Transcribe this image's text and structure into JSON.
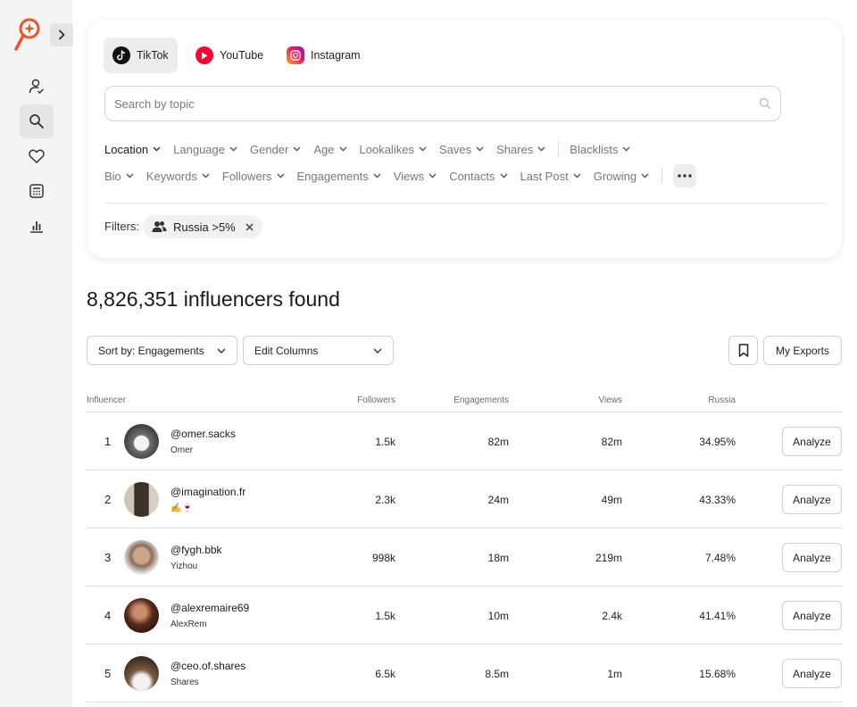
{
  "platforms": [
    {
      "label": "TikTok",
      "icon": "tiktok-icon",
      "active": true
    },
    {
      "label": "YouTube",
      "icon": "youtube-icon",
      "active": false
    },
    {
      "label": "Instagram",
      "icon": "instagram-icon",
      "active": false
    }
  ],
  "search": {
    "placeholder": "Search by topic",
    "value": ""
  },
  "filters_row1": [
    "Location",
    "Language",
    "Gender",
    "Age",
    "Lookalikes",
    "Saves",
    "Shares",
    "Blacklists"
  ],
  "filters_row2": [
    "Bio",
    "Keywords",
    "Followers",
    "Engagements",
    "Views",
    "Contacts",
    "Last Post",
    "Growing"
  ],
  "active_filters": {
    "label": "Filters:",
    "chips": [
      "Russia >5%"
    ]
  },
  "results": {
    "title": "8,826,351 influencers found"
  },
  "controls": {
    "sort_label": "Sort by: Engagements",
    "columns_label": "Edit Columns",
    "exports_label": "My Exports"
  },
  "table": {
    "headers": {
      "influencer": "Influencer",
      "followers": "Followers",
      "engagements": "Engagements",
      "views": "Views",
      "location": "Russia"
    },
    "action_label": "Analyze",
    "rows": [
      {
        "rank": "1",
        "handle": "@omer.sacks",
        "name": "Omer",
        "followers": "1.5k",
        "engagements": "82m",
        "views": "82m",
        "location_pct": "34.95%"
      },
      {
        "rank": "2",
        "handle": "@imagination.fr",
        "name": "✍️🍷",
        "followers": "2.3k",
        "engagements": "24m",
        "views": "49m",
        "location_pct": "43.33%"
      },
      {
        "rank": "3",
        "handle": "@fygh.bbk",
        "name": "Yizhou",
        "followers": "998k",
        "engagements": "18m",
        "views": "219m",
        "location_pct": "7.48%"
      },
      {
        "rank": "4",
        "handle": "@alexremaire69",
        "name": "AlexRem",
        "followers": "1.5k",
        "engagements": "10m",
        "views": "2.4k",
        "location_pct": "41.41%"
      },
      {
        "rank": "5",
        "handle": "@ceo.of.shares",
        "name": "Shares",
        "followers": "6.5k",
        "engagements": "8.5m",
        "views": "1m",
        "location_pct": "15.68%"
      }
    ]
  },
  "colors": {
    "brand": "#e8552c",
    "youtube": "#ff0033",
    "tiktok": "#111111"
  }
}
